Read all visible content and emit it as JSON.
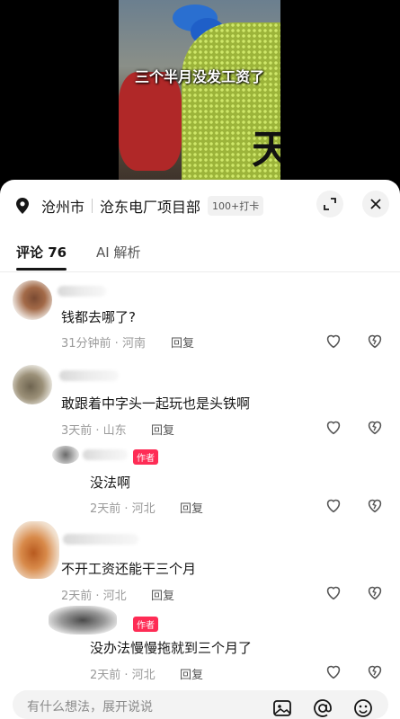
{
  "video": {
    "caption": "三个半月没发工资了",
    "vest_char": "天"
  },
  "header": {
    "city": "沧州市",
    "place": "沧东电厂项目部",
    "checkin_badge": "100+打卡"
  },
  "tabs": [
    {
      "label": "评论 76"
    },
    {
      "label": "AI 解析"
    }
  ],
  "comments": [
    {
      "text": "钱都去哪了?",
      "meta": "31分钟前 · 河南",
      "reply": "回复",
      "is_reply": false
    },
    {
      "text": "敢跟着中字头一起玩也是头铁啊",
      "meta": "3天前 · 山东",
      "reply": "回复",
      "is_reply": false
    },
    {
      "text": "没法啊",
      "meta": "2天前 · 河北",
      "reply": "回复",
      "is_reply": true,
      "tag": "作者"
    },
    {
      "text": "不开工资还能干三个月",
      "meta": "2天前 · 河北",
      "reply": "回复",
      "is_reply": false
    },
    {
      "text": "没办法慢慢拖就到三个月了",
      "meta": "2天前 · 河北",
      "reply": "回复",
      "is_reply": true,
      "tag": "作者"
    }
  ],
  "input": {
    "placeholder": "有什么想法，展开说说"
  },
  "icons": [
    "location-pin-icon",
    "collapse-icon",
    "close-icon",
    "heart-icon",
    "dislike-icon",
    "image-icon",
    "at-icon",
    "emoji-icon"
  ],
  "colors": {
    "author_tag": "#fe2c55",
    "text": "#161616",
    "meta": "#9a9a9a"
  }
}
